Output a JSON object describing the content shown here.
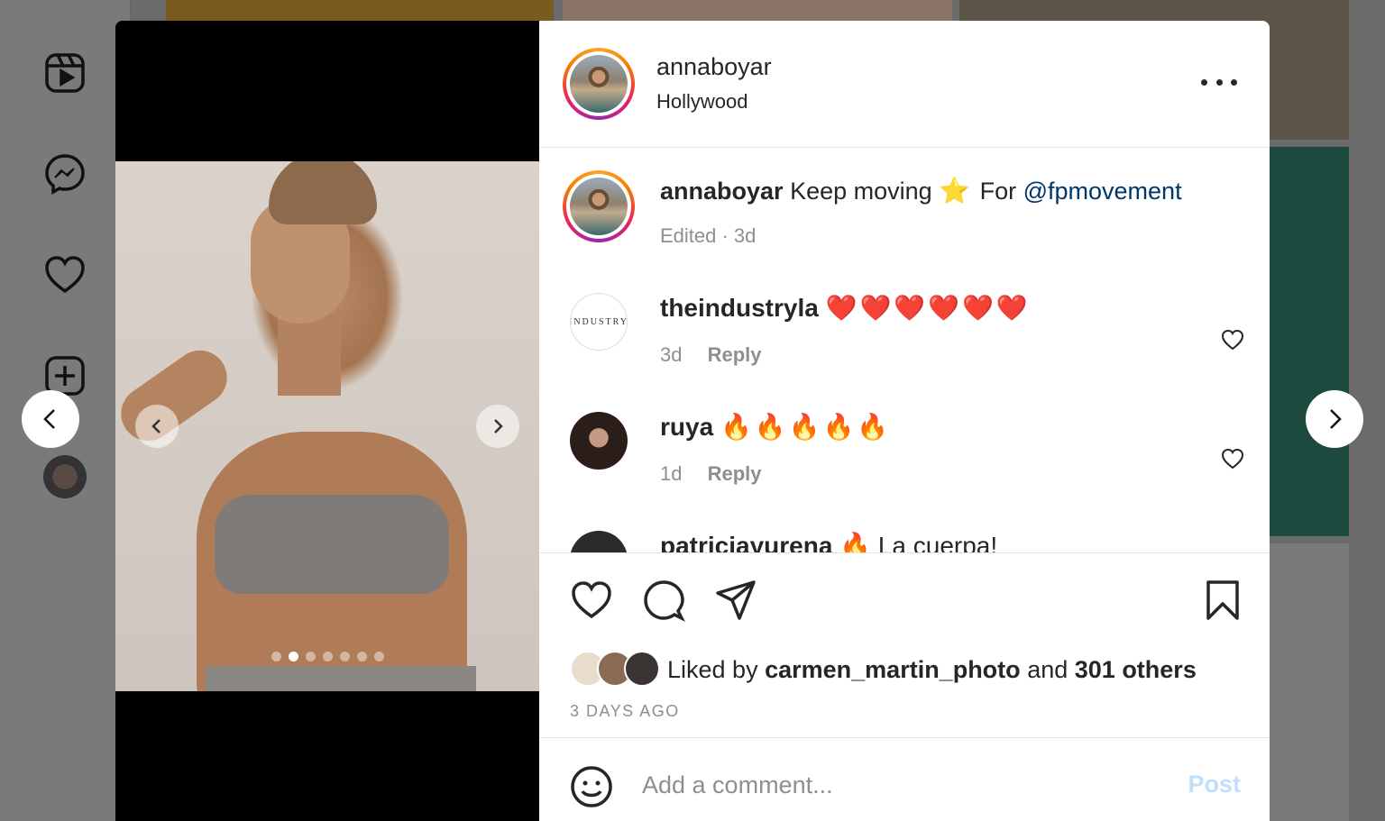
{
  "post": {
    "username": "annaboyar",
    "location": "Hollywood",
    "caption_user": "annaboyar",
    "caption_text": "Keep moving",
    "caption_star": "⭐",
    "caption_for": "For",
    "caption_mention": "@fpmovement",
    "caption_meta": "Edited · 3d",
    "likes_prefix": "Liked by",
    "likes_user": "carmen_martin_photo",
    "likes_and": "and",
    "likes_others": "301 others",
    "date": "3 DAYS AGO"
  },
  "comments": [
    {
      "user": "theindustryla",
      "text": "❤️❤️❤️❤️❤️❤️",
      "time": "3d",
      "reply": "Reply",
      "avatar_text": "INDUSTRY"
    },
    {
      "user": "ruya",
      "text": "🔥🔥🔥🔥🔥",
      "time": "1d",
      "reply": "Reply"
    },
    {
      "user": "patriciayurena",
      "text": "🔥 La cuerpa!"
    }
  ],
  "add_comment": {
    "placeholder": "Add a comment...",
    "post_label": "Post"
  },
  "media": {
    "slide_count": 7,
    "active_slide": 2
  },
  "colors": {
    "accent_link": "#00376b",
    "post_disabled": "#c0dffd",
    "muted_text": "#8e8e8e"
  },
  "icons": {
    "sidebar": [
      "reels-icon",
      "messenger-icon",
      "heart-icon",
      "create-icon"
    ],
    "actions": [
      "like-icon",
      "comment-icon",
      "share-icon",
      "save-icon"
    ]
  }
}
